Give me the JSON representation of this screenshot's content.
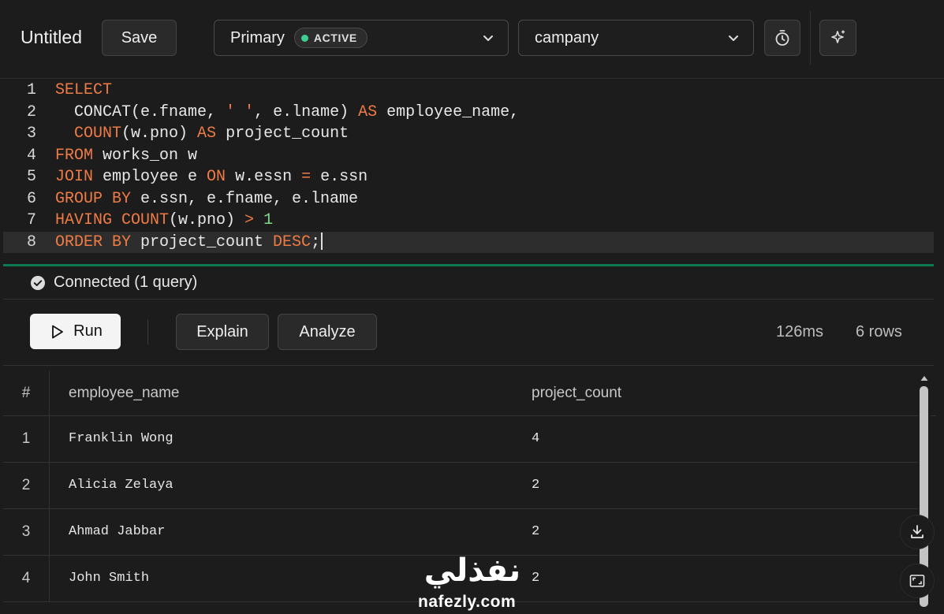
{
  "header": {
    "title": "Untitled",
    "save_label": "Save",
    "database": {
      "label": "Primary",
      "badge": "ACTIVE",
      "badge_color": "#3ecf8e"
    },
    "schema": "campany",
    "timer_icon": "stopwatch-icon",
    "ai_icon": "sparkles-icon"
  },
  "editor": {
    "lines": [
      {
        "n": "1",
        "tokens": [
          [
            "kw",
            "SELECT"
          ]
        ]
      },
      {
        "n": "2",
        "tokens": [
          [
            "t",
            "  CONCAT(e.fname, "
          ],
          [
            "str",
            "' '"
          ],
          [
            "t",
            ", e.lname) "
          ],
          [
            "kw",
            "AS"
          ],
          [
            "t",
            " employee_name,"
          ]
        ]
      },
      {
        "n": "3",
        "tokens": [
          [
            "t",
            "  "
          ],
          [
            "kw",
            "COUNT"
          ],
          [
            "t",
            "(w.pno) "
          ],
          [
            "kw",
            "AS"
          ],
          [
            "t",
            " project_count"
          ]
        ]
      },
      {
        "n": "4",
        "tokens": [
          [
            "kw",
            "FROM"
          ],
          [
            "t",
            " works_on w"
          ]
        ]
      },
      {
        "n": "5",
        "tokens": [
          [
            "kw",
            "JOIN"
          ],
          [
            "t",
            " employee e "
          ],
          [
            "kw",
            "ON"
          ],
          [
            "t",
            " w.essn "
          ],
          [
            "kw",
            "="
          ],
          [
            "t",
            " e.ssn"
          ]
        ]
      },
      {
        "n": "6",
        "tokens": [
          [
            "kw",
            "GROUP BY"
          ],
          [
            "t",
            " e.ssn, e.fname, e.lname"
          ]
        ]
      },
      {
        "n": "7",
        "tokens": [
          [
            "kw",
            "HAVING COUNT"
          ],
          [
            "t",
            "(w.pno) "
          ],
          [
            "kw",
            ">"
          ],
          [
            "t",
            " "
          ],
          [
            "num",
            "1"
          ]
        ]
      },
      {
        "n": "8",
        "tokens": [
          [
            "kw",
            "ORDER BY"
          ],
          [
            "t",
            " project_count "
          ],
          [
            "kw",
            "DESC"
          ],
          [
            "t",
            ";"
          ]
        ],
        "active": true
      }
    ]
  },
  "status": {
    "text": "Connected (1 query)",
    "icon": "check-circle-icon"
  },
  "toolbar": {
    "run_label": "Run",
    "explain_label": "Explain",
    "analyze_label": "Analyze",
    "duration": "126ms",
    "rows": "6 rows"
  },
  "results": {
    "columns": [
      "#",
      "employee_name",
      "project_count"
    ],
    "rows": [
      [
        "1",
        "Franklin Wong",
        "4"
      ],
      [
        "2",
        "Alicia Zelaya",
        "2"
      ],
      [
        "3",
        "Ahmad Jabbar",
        "2"
      ],
      [
        "4",
        "John Smith",
        "2"
      ]
    ]
  },
  "watermark": {
    "arabic": "نفذلي",
    "url": "nafezly.com"
  }
}
